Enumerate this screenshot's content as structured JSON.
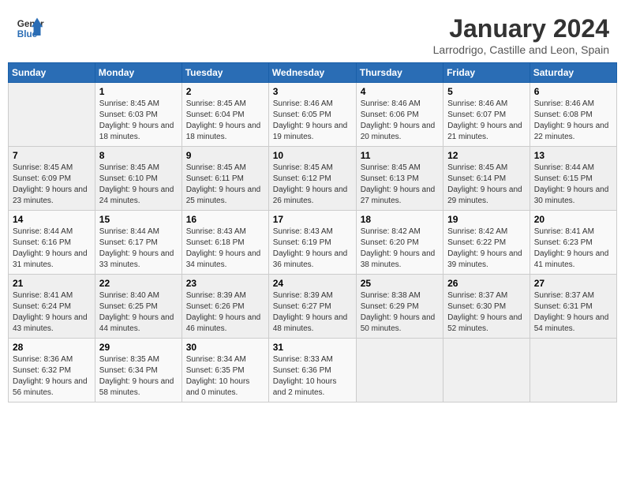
{
  "logo": {
    "line1": "General",
    "line2": "Blue"
  },
  "title": "January 2024",
  "subtitle": "Larrodrigo, Castille and Leon, Spain",
  "weekdays": [
    "Sunday",
    "Monday",
    "Tuesday",
    "Wednesday",
    "Thursday",
    "Friday",
    "Saturday"
  ],
  "weeks": [
    [
      {
        "day": "",
        "sunrise": "",
        "sunset": "",
        "daylight": ""
      },
      {
        "day": "1",
        "sunrise": "Sunrise: 8:45 AM",
        "sunset": "Sunset: 6:03 PM",
        "daylight": "Daylight: 9 hours and 18 minutes."
      },
      {
        "day": "2",
        "sunrise": "Sunrise: 8:45 AM",
        "sunset": "Sunset: 6:04 PM",
        "daylight": "Daylight: 9 hours and 18 minutes."
      },
      {
        "day": "3",
        "sunrise": "Sunrise: 8:46 AM",
        "sunset": "Sunset: 6:05 PM",
        "daylight": "Daylight: 9 hours and 19 minutes."
      },
      {
        "day": "4",
        "sunrise": "Sunrise: 8:46 AM",
        "sunset": "Sunset: 6:06 PM",
        "daylight": "Daylight: 9 hours and 20 minutes."
      },
      {
        "day": "5",
        "sunrise": "Sunrise: 8:46 AM",
        "sunset": "Sunset: 6:07 PM",
        "daylight": "Daylight: 9 hours and 21 minutes."
      },
      {
        "day": "6",
        "sunrise": "Sunrise: 8:46 AM",
        "sunset": "Sunset: 6:08 PM",
        "daylight": "Daylight: 9 hours and 22 minutes."
      }
    ],
    [
      {
        "day": "7",
        "sunrise": "Sunrise: 8:45 AM",
        "sunset": "Sunset: 6:09 PM",
        "daylight": "Daylight: 9 hours and 23 minutes."
      },
      {
        "day": "8",
        "sunrise": "Sunrise: 8:45 AM",
        "sunset": "Sunset: 6:10 PM",
        "daylight": "Daylight: 9 hours and 24 minutes."
      },
      {
        "day": "9",
        "sunrise": "Sunrise: 8:45 AM",
        "sunset": "Sunset: 6:11 PM",
        "daylight": "Daylight: 9 hours and 25 minutes."
      },
      {
        "day": "10",
        "sunrise": "Sunrise: 8:45 AM",
        "sunset": "Sunset: 6:12 PM",
        "daylight": "Daylight: 9 hours and 26 minutes."
      },
      {
        "day": "11",
        "sunrise": "Sunrise: 8:45 AM",
        "sunset": "Sunset: 6:13 PM",
        "daylight": "Daylight: 9 hours and 27 minutes."
      },
      {
        "day": "12",
        "sunrise": "Sunrise: 8:45 AM",
        "sunset": "Sunset: 6:14 PM",
        "daylight": "Daylight: 9 hours and 29 minutes."
      },
      {
        "day": "13",
        "sunrise": "Sunrise: 8:44 AM",
        "sunset": "Sunset: 6:15 PM",
        "daylight": "Daylight: 9 hours and 30 minutes."
      }
    ],
    [
      {
        "day": "14",
        "sunrise": "Sunrise: 8:44 AM",
        "sunset": "Sunset: 6:16 PM",
        "daylight": "Daylight: 9 hours and 31 minutes."
      },
      {
        "day": "15",
        "sunrise": "Sunrise: 8:44 AM",
        "sunset": "Sunset: 6:17 PM",
        "daylight": "Daylight: 9 hours and 33 minutes."
      },
      {
        "day": "16",
        "sunrise": "Sunrise: 8:43 AM",
        "sunset": "Sunset: 6:18 PM",
        "daylight": "Daylight: 9 hours and 34 minutes."
      },
      {
        "day": "17",
        "sunrise": "Sunrise: 8:43 AM",
        "sunset": "Sunset: 6:19 PM",
        "daylight": "Daylight: 9 hours and 36 minutes."
      },
      {
        "day": "18",
        "sunrise": "Sunrise: 8:42 AM",
        "sunset": "Sunset: 6:20 PM",
        "daylight": "Daylight: 9 hours and 38 minutes."
      },
      {
        "day": "19",
        "sunrise": "Sunrise: 8:42 AM",
        "sunset": "Sunset: 6:22 PM",
        "daylight": "Daylight: 9 hours and 39 minutes."
      },
      {
        "day": "20",
        "sunrise": "Sunrise: 8:41 AM",
        "sunset": "Sunset: 6:23 PM",
        "daylight": "Daylight: 9 hours and 41 minutes."
      }
    ],
    [
      {
        "day": "21",
        "sunrise": "Sunrise: 8:41 AM",
        "sunset": "Sunset: 6:24 PM",
        "daylight": "Daylight: 9 hours and 43 minutes."
      },
      {
        "day": "22",
        "sunrise": "Sunrise: 8:40 AM",
        "sunset": "Sunset: 6:25 PM",
        "daylight": "Daylight: 9 hours and 44 minutes."
      },
      {
        "day": "23",
        "sunrise": "Sunrise: 8:39 AM",
        "sunset": "Sunset: 6:26 PM",
        "daylight": "Daylight: 9 hours and 46 minutes."
      },
      {
        "day": "24",
        "sunrise": "Sunrise: 8:39 AM",
        "sunset": "Sunset: 6:27 PM",
        "daylight": "Daylight: 9 hours and 48 minutes."
      },
      {
        "day": "25",
        "sunrise": "Sunrise: 8:38 AM",
        "sunset": "Sunset: 6:29 PM",
        "daylight": "Daylight: 9 hours and 50 minutes."
      },
      {
        "day": "26",
        "sunrise": "Sunrise: 8:37 AM",
        "sunset": "Sunset: 6:30 PM",
        "daylight": "Daylight: 9 hours and 52 minutes."
      },
      {
        "day": "27",
        "sunrise": "Sunrise: 8:37 AM",
        "sunset": "Sunset: 6:31 PM",
        "daylight": "Daylight: 9 hours and 54 minutes."
      }
    ],
    [
      {
        "day": "28",
        "sunrise": "Sunrise: 8:36 AM",
        "sunset": "Sunset: 6:32 PM",
        "daylight": "Daylight: 9 hours and 56 minutes."
      },
      {
        "day": "29",
        "sunrise": "Sunrise: 8:35 AM",
        "sunset": "Sunset: 6:34 PM",
        "daylight": "Daylight: 9 hours and 58 minutes."
      },
      {
        "day": "30",
        "sunrise": "Sunrise: 8:34 AM",
        "sunset": "Sunset: 6:35 PM",
        "daylight": "Daylight: 10 hours and 0 minutes."
      },
      {
        "day": "31",
        "sunrise": "Sunrise: 8:33 AM",
        "sunset": "Sunset: 6:36 PM",
        "daylight": "Daylight: 10 hours and 2 minutes."
      },
      {
        "day": "",
        "sunrise": "",
        "sunset": "",
        "daylight": ""
      },
      {
        "day": "",
        "sunrise": "",
        "sunset": "",
        "daylight": ""
      },
      {
        "day": "",
        "sunrise": "",
        "sunset": "",
        "daylight": ""
      }
    ]
  ]
}
